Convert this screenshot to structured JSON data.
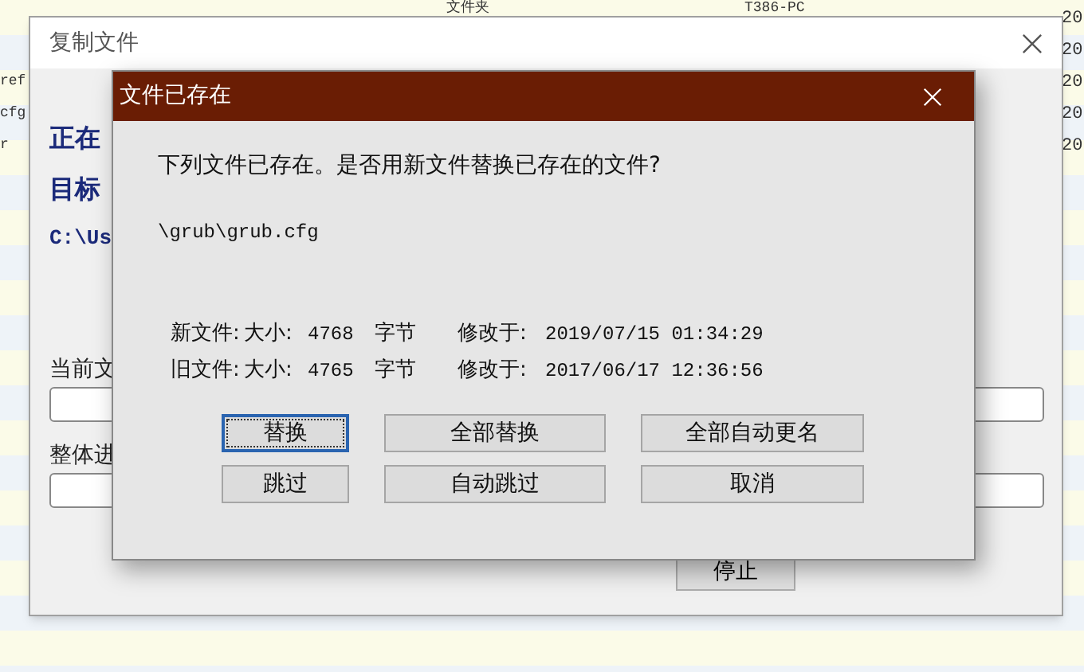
{
  "background_list": {
    "header_cells": [
      "文件夹",
      "T386-PC"
    ],
    "left_fragments": [
      "ref",
      "cfg",
      "r"
    ],
    "right_fragments": [
      "20",
      "20",
      "20",
      "20",
      "20"
    ]
  },
  "copy_window": {
    "title": "复制文件",
    "status_labels": [
      "正在",
      "目标"
    ],
    "path": "C:\\Us",
    "progress": [
      {
        "label": "当前文"
      },
      {
        "label": "整体进"
      }
    ],
    "stop_button": "停止"
  },
  "dialog": {
    "title": "文件已存在",
    "question": "下列文件已存在。是否用新文件替换已存在的文件?",
    "file_path": "\\grub\\grub.cfg",
    "file_info": [
      {
        "label": "新文件:",
        "size_label": "大小:",
        "size": "4768",
        "unit": "字节",
        "modified_label": "修改于:",
        "modified": "2019/07/15 01:34:29"
      },
      {
        "label": "旧文件:",
        "size_label": "大小:",
        "size": "4765",
        "unit": "字节",
        "modified_label": "修改于:",
        "modified": "2017/06/17 12:36:56"
      }
    ],
    "buttons": [
      {
        "label": "替换",
        "selected": true
      },
      {
        "label": "全部替换",
        "selected": false
      },
      {
        "label": "全部自动更名",
        "selected": false
      },
      {
        "label": "跳过",
        "selected": false
      },
      {
        "label": "自动跳过",
        "selected": false
      },
      {
        "label": "取消",
        "selected": false
      }
    ]
  }
}
